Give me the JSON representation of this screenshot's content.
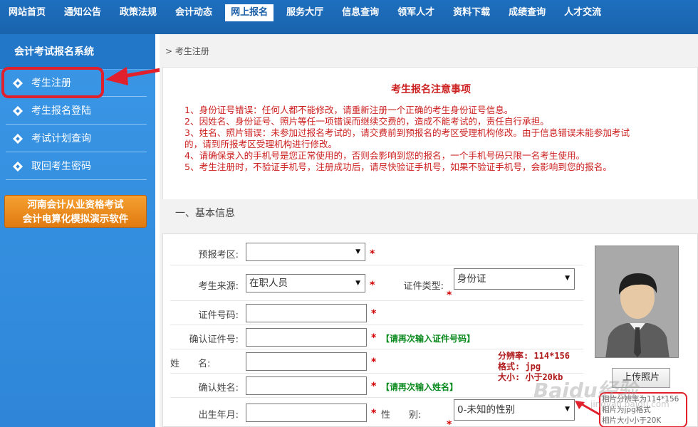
{
  "topnav": {
    "items": [
      "网站首页",
      "通知公告",
      "政策法规",
      "会计动态",
      "网上报名",
      "服务大厅",
      "信息查询",
      "领军人才",
      "资料下载",
      "成绩查询",
      "人才交流"
    ],
    "active_index": 4
  },
  "sidebar": {
    "title": "会计考试报名系统",
    "items": [
      {
        "label": "考生注册",
        "icon": "diamond-bullet-icon"
      },
      {
        "label": "考生报名登陆",
        "icon": "diamond-bullet-icon"
      },
      {
        "label": "考试计划查询",
        "icon": "diamond-bullet-icon"
      },
      {
        "label": "取回考生密码",
        "icon": "diamond-bullet-icon"
      }
    ],
    "banner_line1": "河南会计从业资格考试",
    "banner_line2": "会计电算化模拟演示软件"
  },
  "breadcrumb": "考生注册",
  "notice": {
    "title": "考生报名注意事项",
    "lines": [
      "1、身份证号错误：任何人都不能修改，请重新注册一个正确的考生身份证号信息。",
      "2、因姓名、身份证号、照片等任一项错误而继续交费的，造成不能考试的，责任自行承担。",
      "3、姓名、照片错误：未参加过报名考试的，请交费前到预报名的考区受理机构修改。由于信息错误未能参加考试",
      "的，请到所报考区受理机构进行修改。",
      "4、请确保录入的手机号是您正常使用的，否则会影响到您的报名，一个手机号码只限一名考生使用。",
      "5、考生注册时，不验证手机号，注册成功后，请尽快验证手机号，如果不验证手机号，会影响到您的报名。"
    ]
  },
  "section_title": "一、基本信息",
  "form": {
    "exam_area_label": "预报考区:",
    "exam_area_value": "",
    "source_label": "考生来源:",
    "source_value": "在职人员",
    "id_type_label": "证件类型:",
    "id_type_value": "身份证",
    "id_no_label": "证件号码:",
    "id_no_value": "",
    "id_confirm_label": "确认证件号:",
    "id_confirm_value": "",
    "id_confirm_hint": "【请再次输入证件号码】",
    "name_label": "姓　　名:",
    "name_value": "",
    "name_confirm_label": "确认姓名:",
    "name_confirm_value": "",
    "name_confirm_hint": "【请再次输入姓名】",
    "birth_label": "出生年月:",
    "birth_value": "",
    "gender_label": "性　　别:",
    "gender_value": "0-未知的性别",
    "required_mark": "*"
  },
  "photo": {
    "upload_label": "上传照片",
    "info_line1": "分辨率: 114*156",
    "info_line2": "格式: jpg",
    "info_line3": "大小: 小于20kb",
    "note_line1": "相片分辨率为114*156",
    "note_line2": "相片为jpg格式",
    "note_line3": "相片大小小于20K"
  },
  "watermark": {
    "text": "Baidu经验",
    "sub": "jingyan.baidu.com"
  },
  "colors": {
    "nav_blue": "#1a63ad",
    "sidebar_blue": "#2f86d8",
    "notice_red": "#cc1f1f",
    "hint_green": "#0b8a1f",
    "annotation_red": "#e0202c"
  }
}
